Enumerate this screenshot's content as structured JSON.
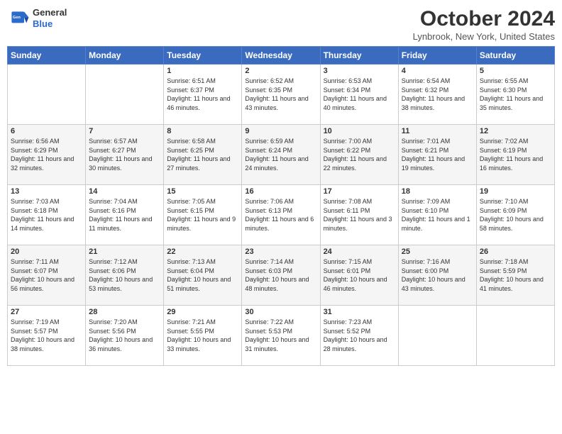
{
  "header": {
    "logo_line1": "General",
    "logo_line2": "Blue",
    "month": "October 2024",
    "location": "Lynbrook, New York, United States"
  },
  "days_of_week": [
    "Sunday",
    "Monday",
    "Tuesday",
    "Wednesday",
    "Thursday",
    "Friday",
    "Saturday"
  ],
  "weeks": [
    [
      {
        "num": "",
        "detail": ""
      },
      {
        "num": "",
        "detail": ""
      },
      {
        "num": "1",
        "detail": "Sunrise: 6:51 AM\nSunset: 6:37 PM\nDaylight: 11 hours and 46 minutes."
      },
      {
        "num": "2",
        "detail": "Sunrise: 6:52 AM\nSunset: 6:35 PM\nDaylight: 11 hours and 43 minutes."
      },
      {
        "num": "3",
        "detail": "Sunrise: 6:53 AM\nSunset: 6:34 PM\nDaylight: 11 hours and 40 minutes."
      },
      {
        "num": "4",
        "detail": "Sunrise: 6:54 AM\nSunset: 6:32 PM\nDaylight: 11 hours and 38 minutes."
      },
      {
        "num": "5",
        "detail": "Sunrise: 6:55 AM\nSunset: 6:30 PM\nDaylight: 11 hours and 35 minutes."
      }
    ],
    [
      {
        "num": "6",
        "detail": "Sunrise: 6:56 AM\nSunset: 6:29 PM\nDaylight: 11 hours and 32 minutes."
      },
      {
        "num": "7",
        "detail": "Sunrise: 6:57 AM\nSunset: 6:27 PM\nDaylight: 11 hours and 30 minutes."
      },
      {
        "num": "8",
        "detail": "Sunrise: 6:58 AM\nSunset: 6:25 PM\nDaylight: 11 hours and 27 minutes."
      },
      {
        "num": "9",
        "detail": "Sunrise: 6:59 AM\nSunset: 6:24 PM\nDaylight: 11 hours and 24 minutes."
      },
      {
        "num": "10",
        "detail": "Sunrise: 7:00 AM\nSunset: 6:22 PM\nDaylight: 11 hours and 22 minutes."
      },
      {
        "num": "11",
        "detail": "Sunrise: 7:01 AM\nSunset: 6:21 PM\nDaylight: 11 hours and 19 minutes."
      },
      {
        "num": "12",
        "detail": "Sunrise: 7:02 AM\nSunset: 6:19 PM\nDaylight: 11 hours and 16 minutes."
      }
    ],
    [
      {
        "num": "13",
        "detail": "Sunrise: 7:03 AM\nSunset: 6:18 PM\nDaylight: 11 hours and 14 minutes."
      },
      {
        "num": "14",
        "detail": "Sunrise: 7:04 AM\nSunset: 6:16 PM\nDaylight: 11 hours and 11 minutes."
      },
      {
        "num": "15",
        "detail": "Sunrise: 7:05 AM\nSunset: 6:15 PM\nDaylight: 11 hours and 9 minutes."
      },
      {
        "num": "16",
        "detail": "Sunrise: 7:06 AM\nSunset: 6:13 PM\nDaylight: 11 hours and 6 minutes."
      },
      {
        "num": "17",
        "detail": "Sunrise: 7:08 AM\nSunset: 6:11 PM\nDaylight: 11 hours and 3 minutes."
      },
      {
        "num": "18",
        "detail": "Sunrise: 7:09 AM\nSunset: 6:10 PM\nDaylight: 11 hours and 1 minute."
      },
      {
        "num": "19",
        "detail": "Sunrise: 7:10 AM\nSunset: 6:09 PM\nDaylight: 10 hours and 58 minutes."
      }
    ],
    [
      {
        "num": "20",
        "detail": "Sunrise: 7:11 AM\nSunset: 6:07 PM\nDaylight: 10 hours and 56 minutes."
      },
      {
        "num": "21",
        "detail": "Sunrise: 7:12 AM\nSunset: 6:06 PM\nDaylight: 10 hours and 53 minutes."
      },
      {
        "num": "22",
        "detail": "Sunrise: 7:13 AM\nSunset: 6:04 PM\nDaylight: 10 hours and 51 minutes."
      },
      {
        "num": "23",
        "detail": "Sunrise: 7:14 AM\nSunset: 6:03 PM\nDaylight: 10 hours and 48 minutes."
      },
      {
        "num": "24",
        "detail": "Sunrise: 7:15 AM\nSunset: 6:01 PM\nDaylight: 10 hours and 46 minutes."
      },
      {
        "num": "25",
        "detail": "Sunrise: 7:16 AM\nSunset: 6:00 PM\nDaylight: 10 hours and 43 minutes."
      },
      {
        "num": "26",
        "detail": "Sunrise: 7:18 AM\nSunset: 5:59 PM\nDaylight: 10 hours and 41 minutes."
      }
    ],
    [
      {
        "num": "27",
        "detail": "Sunrise: 7:19 AM\nSunset: 5:57 PM\nDaylight: 10 hours and 38 minutes."
      },
      {
        "num": "28",
        "detail": "Sunrise: 7:20 AM\nSunset: 5:56 PM\nDaylight: 10 hours and 36 minutes."
      },
      {
        "num": "29",
        "detail": "Sunrise: 7:21 AM\nSunset: 5:55 PM\nDaylight: 10 hours and 33 minutes."
      },
      {
        "num": "30",
        "detail": "Sunrise: 7:22 AM\nSunset: 5:53 PM\nDaylight: 10 hours and 31 minutes."
      },
      {
        "num": "31",
        "detail": "Sunrise: 7:23 AM\nSunset: 5:52 PM\nDaylight: 10 hours and 28 minutes."
      },
      {
        "num": "",
        "detail": ""
      },
      {
        "num": "",
        "detail": ""
      }
    ]
  ]
}
